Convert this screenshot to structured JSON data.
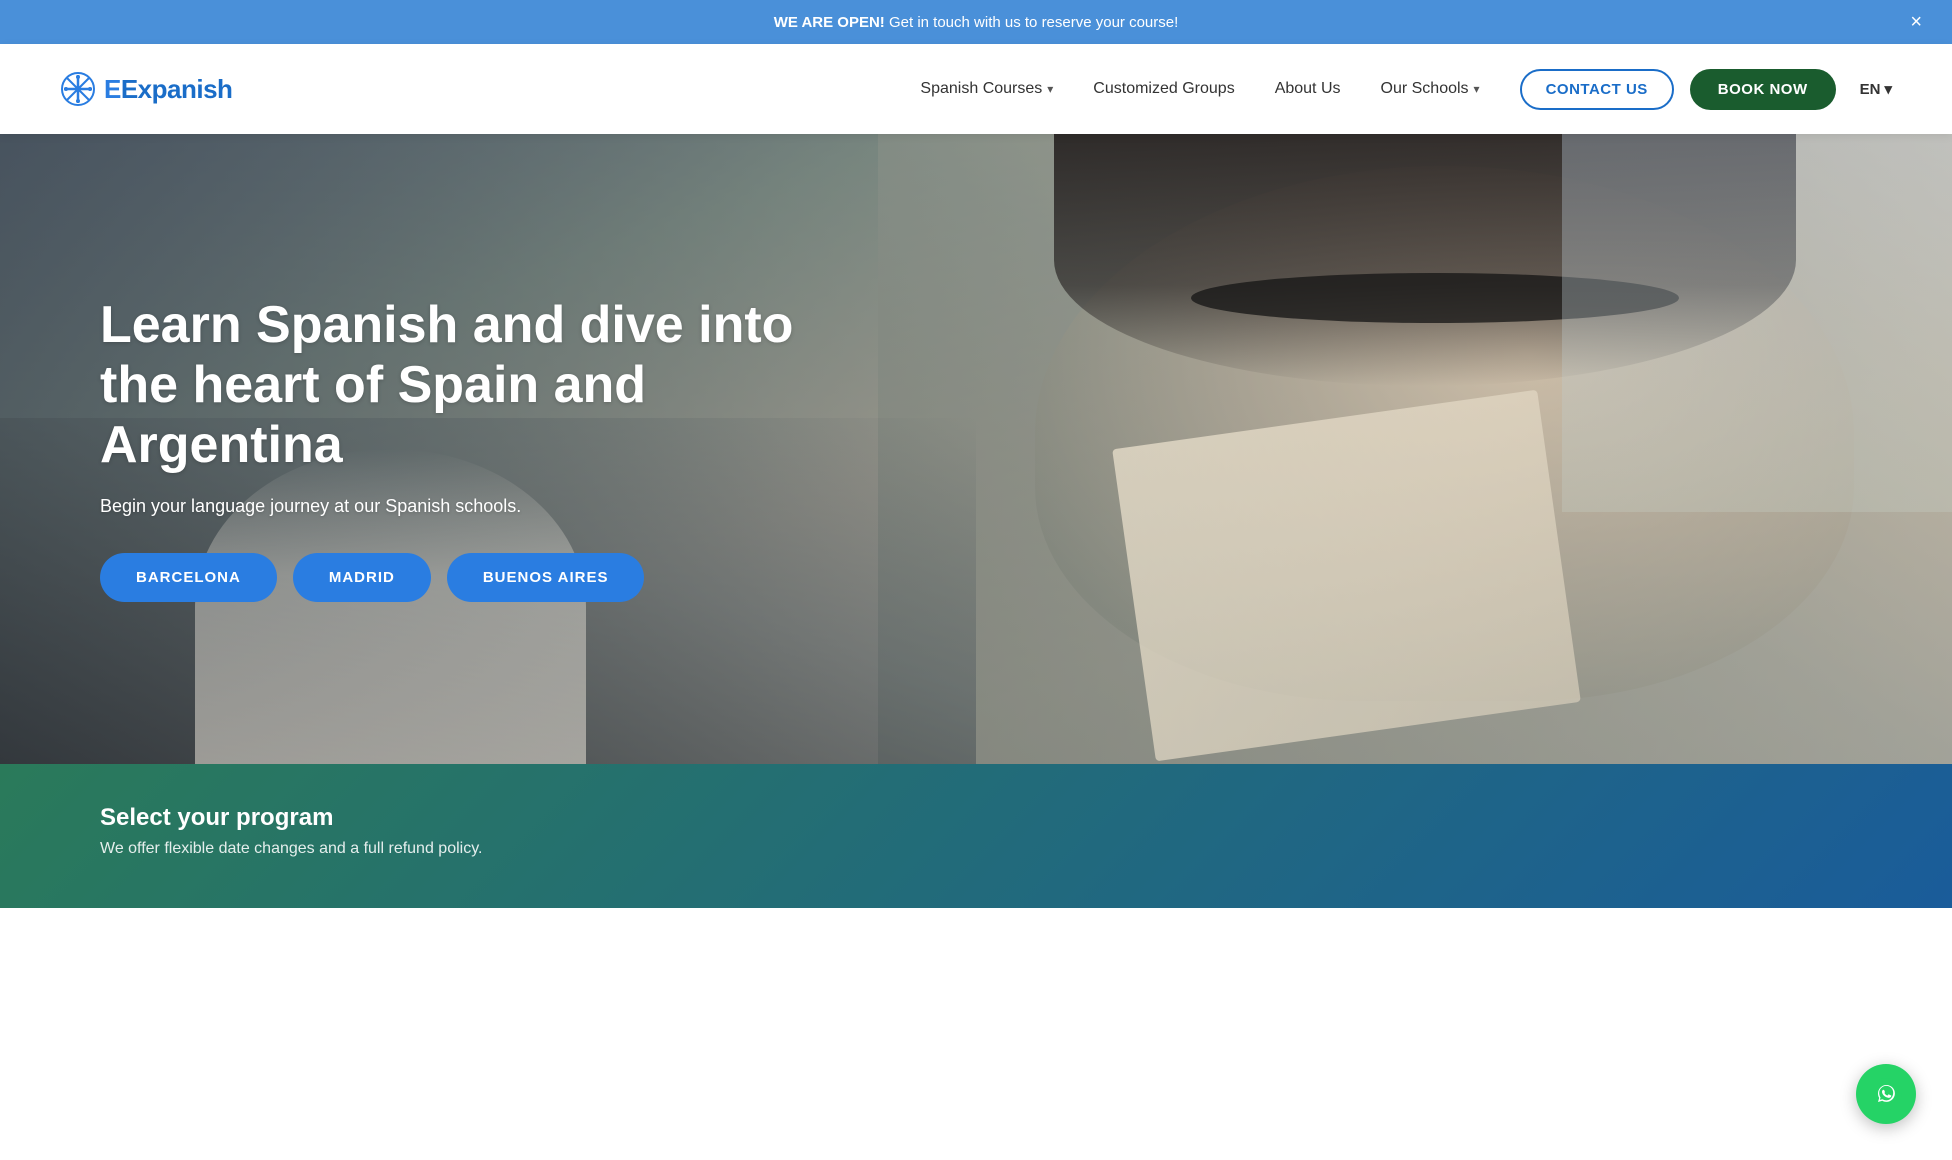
{
  "announcement": {
    "bold": "WE ARE OPEN!",
    "text": " Get in touch with us to reserve your course!",
    "close_label": "×"
  },
  "nav": {
    "logo_text": "Expanish",
    "links": [
      {
        "id": "spanish-courses",
        "label": "Spanish Courses",
        "has_dropdown": true
      },
      {
        "id": "customized-groups",
        "label": "Customized Groups",
        "has_dropdown": false
      },
      {
        "id": "about-us",
        "label": "About Us",
        "has_dropdown": false
      },
      {
        "id": "our-schools",
        "label": "Our Schools",
        "has_dropdown": true
      }
    ],
    "contact_label": "CONTACT US",
    "book_label": "BOOK NOW",
    "lang": "EN",
    "lang_chevron": "▾"
  },
  "hero": {
    "title": "Learn Spanish and dive into the heart of Spain and Argentina",
    "subtitle": "Begin your language journey at our Spanish schools.",
    "buttons": [
      {
        "id": "barcelona",
        "label": "BARCELONA"
      },
      {
        "id": "madrid",
        "label": "MADRID"
      },
      {
        "id": "buenos-aires",
        "label": "BUENOS AIRES"
      }
    ]
  },
  "bottom": {
    "heading": "Select your program",
    "subtext": "We offer flexible date changes and a full refund policy."
  },
  "whatsapp": {
    "icon": "💬",
    "label": "WhatsApp"
  },
  "colors": {
    "blue": "#1a6dc8",
    "dark_green": "#1a5c2e",
    "hero_btn": "#2a7de1",
    "whatsapp": "#25d366"
  }
}
